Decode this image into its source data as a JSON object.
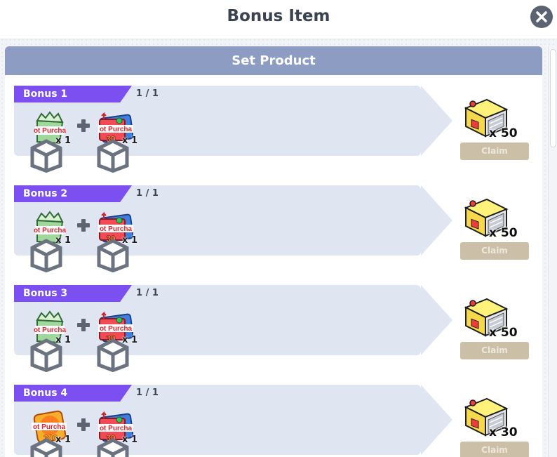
{
  "window": {
    "title": "Bonus Item"
  },
  "panel": {
    "heading": "Set Product"
  },
  "colors": {
    "bonus_tag": "#7c4ff0",
    "panel_header": "#8c9cc3",
    "row_bg": "#e0e6f1",
    "claim_button": "#cbbfa7"
  },
  "rows": [
    {
      "label": "Bonus 1",
      "count": "1 / 1",
      "items": [
        {
          "icon": "green-purchase-bag-icon",
          "qty": "x 1"
        },
        {
          "icon": "red-purchase-ticket-30-icon",
          "qty": "x 1"
        }
      ],
      "reward": {
        "icon": "yellow-gift-box-icon",
        "qty": "x 50"
      },
      "claim_label": "Claim"
    },
    {
      "label": "Bonus 2",
      "count": "1 / 1",
      "items": [
        {
          "icon": "green-purchase-bag-icon",
          "qty": "x 1"
        },
        {
          "icon": "red-purchase-ticket-30-icon",
          "qty": "x 1"
        }
      ],
      "reward": {
        "icon": "yellow-gift-box-icon",
        "qty": "x 50"
      },
      "claim_label": "Claim"
    },
    {
      "label": "Bonus 3",
      "count": "1 / 1",
      "items": [
        {
          "icon": "green-purchase-bag-icon",
          "qty": "x 1"
        },
        {
          "icon": "red-purchase-ticket-30-icon",
          "qty": "x 1"
        }
      ],
      "reward": {
        "icon": "yellow-gift-box-icon",
        "qty": "x 50"
      },
      "claim_label": "Claim"
    },
    {
      "label": "Bonus 4",
      "count": "1 / 1",
      "items": [
        {
          "icon": "orange-purchase-ticket-300-icon",
          "qty": "x 1"
        },
        {
          "icon": "red-purchase-ticket-30-icon",
          "qty": "x 1"
        }
      ],
      "reward": {
        "icon": "yellow-gift-box-icon",
        "qty": "x 30"
      },
      "claim_label": "Claim"
    }
  ]
}
